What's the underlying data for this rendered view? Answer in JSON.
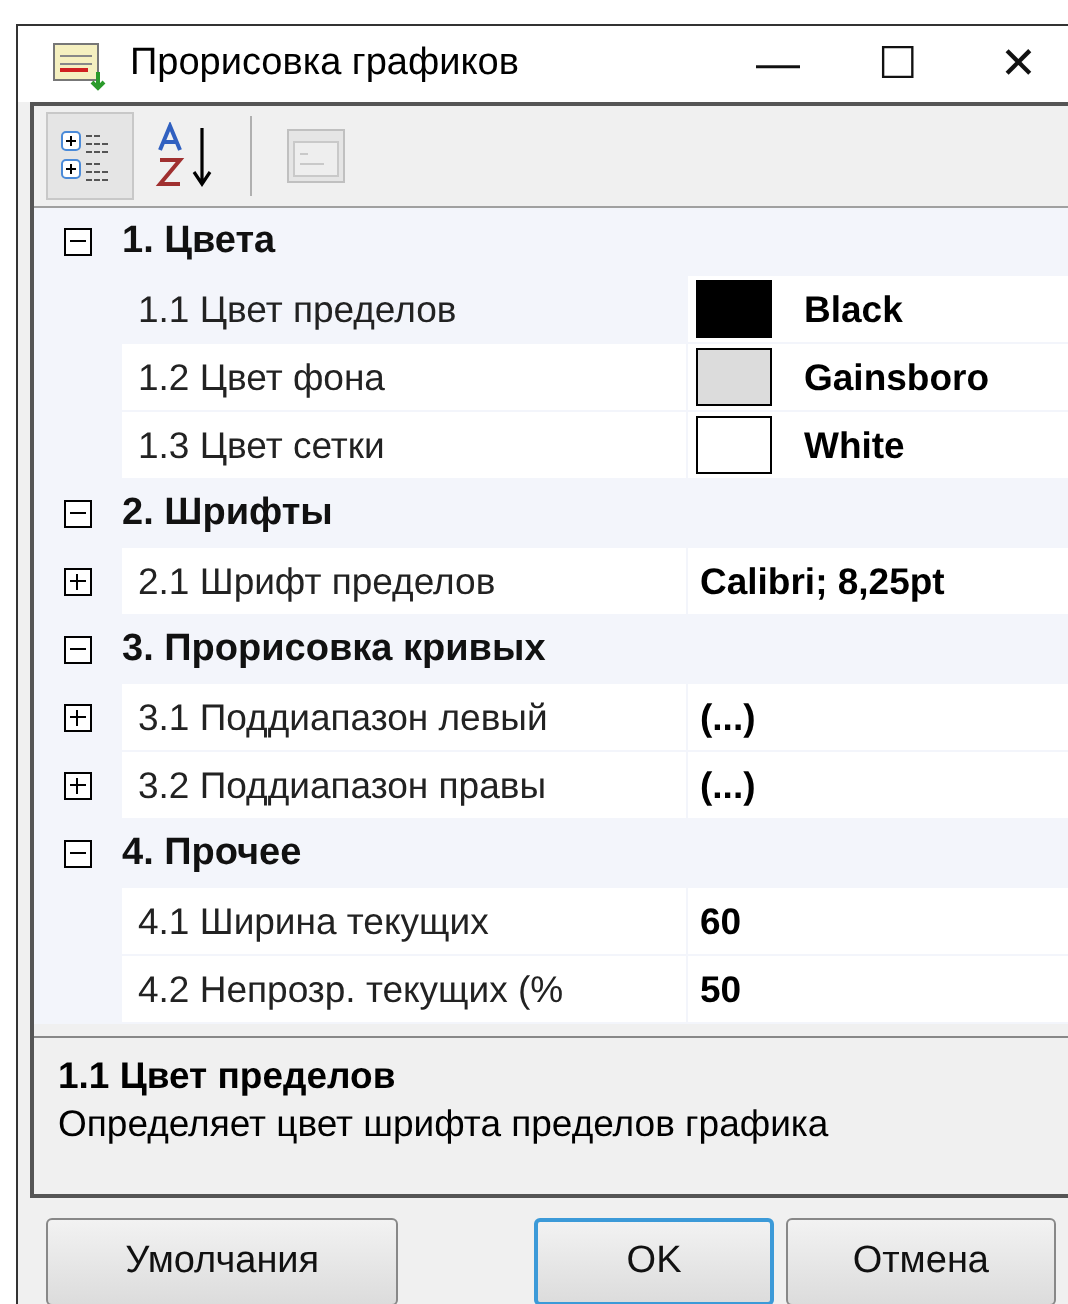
{
  "window": {
    "title": "Прорисовка графиков",
    "controls": [
      "—",
      "☐",
      "✕"
    ]
  },
  "toolbar": [
    {
      "kind": "categorized",
      "selected": true,
      "disabled": false
    },
    {
      "kind": "alphabetical",
      "selected": false,
      "disabled": false
    },
    {
      "kind": "pages",
      "selected": false,
      "disabled": true
    }
  ],
  "grid": {
    "categories": [
      {
        "label": "1. Цвета",
        "expanded": true,
        "properties": [
          {
            "kind": "color",
            "label": "1.1 Цвет пределов",
            "value": "Black",
            "color": "#000000",
            "selected": true
          },
          {
            "kind": "color",
            "label": "1.2 Цвет фона",
            "value": "Gainsboro",
            "color": "#dcdcdc",
            "selected": false
          },
          {
            "kind": "color",
            "label": "1.3 Цвет сетки",
            "value": "White",
            "color": "#ffffff",
            "selected": false
          }
        ]
      },
      {
        "label": "2. Шрифты",
        "expanded": true,
        "properties": [
          {
            "kind": "text",
            "label": "2.1 Шрифт пределов",
            "value": "Calibri; 8,25pt",
            "expandable": true,
            "expanded": false,
            "selected": false
          }
        ]
      },
      {
        "label": "3. Прорисовка кривых",
        "expanded": true,
        "properties": [
          {
            "kind": "text",
            "label": "3.1 Поддиапазон левый",
            "value": "(...)",
            "expandable": true,
            "expanded": false,
            "selected": false
          },
          {
            "kind": "text",
            "label": "3.2 Поддиапазон правы",
            "value": "(...)",
            "expandable": true,
            "expanded": false,
            "selected": false
          }
        ]
      },
      {
        "label": "4. Прочее",
        "expanded": true,
        "properties": [
          {
            "kind": "text",
            "label": "4.1 Ширина текущих",
            "value": "60",
            "selected": false
          },
          {
            "kind": "text",
            "label": "4.2 Непрозр. текущих (%",
            "value": "50",
            "selected": false
          }
        ]
      }
    ]
  },
  "description": {
    "title": "1.1 Цвет пределов",
    "text": "Определяет цвет шрифта пределов графика"
  },
  "buttons": [
    {
      "label": "Умолчания",
      "default": false
    },
    {
      "label": "OK",
      "default": true
    },
    {
      "label": "Отмена",
      "default": false
    }
  ]
}
